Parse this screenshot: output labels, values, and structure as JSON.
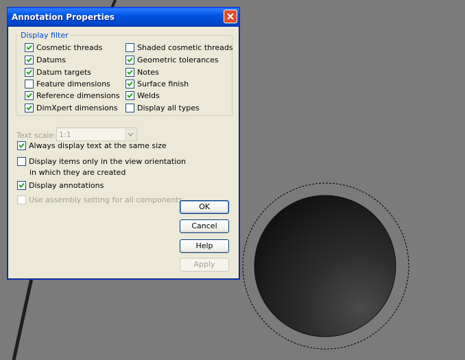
{
  "dialog": {
    "title": "Annotation Properties",
    "display_filter": {
      "legend": "Display filter",
      "left_column": [
        {
          "label": "Cosmetic threads",
          "checked": true
        },
        {
          "label": "Datums",
          "checked": true
        },
        {
          "label": "Datum targets",
          "checked": true
        },
        {
          "label": "Feature dimensions",
          "checked": false
        },
        {
          "label": "Reference dimensions",
          "checked": true
        },
        {
          "label": "DimXpert dimensions",
          "checked": true
        }
      ],
      "right_column": [
        {
          "label": "Shaded cosmetic threads",
          "checked": false
        },
        {
          "label": "Geometric tolerances",
          "checked": true
        },
        {
          "label": "Notes",
          "checked": true
        },
        {
          "label": "Surface finish",
          "checked": true
        },
        {
          "label": "Welds",
          "checked": true
        },
        {
          "label": "Display all types",
          "checked": false
        }
      ]
    },
    "text_scale": {
      "label": "Text scale:",
      "value": "1:1"
    },
    "options": [
      {
        "label": "Always display text at the same size",
        "checked": true,
        "enabled": true
      },
      {
        "label_line1": "Display items only in the view orientation",
        "label_line2": "in which they are created",
        "checked": false,
        "enabled": true
      },
      {
        "label": "Display annotations",
        "checked": true,
        "enabled": true
      },
      {
        "label": "Use assembly setting for all components",
        "checked": false,
        "enabled": false
      }
    ],
    "buttons": {
      "ok": "OK",
      "cancel": "Cancel",
      "help": "Help",
      "apply": "Apply"
    }
  },
  "colors": {
    "title_bar": "#0054e3",
    "dialog_bg": "#ece9d8",
    "viewport_bg": "#7b7b7b",
    "check_mark": "#21a121",
    "group_legend": "#0046d5"
  }
}
